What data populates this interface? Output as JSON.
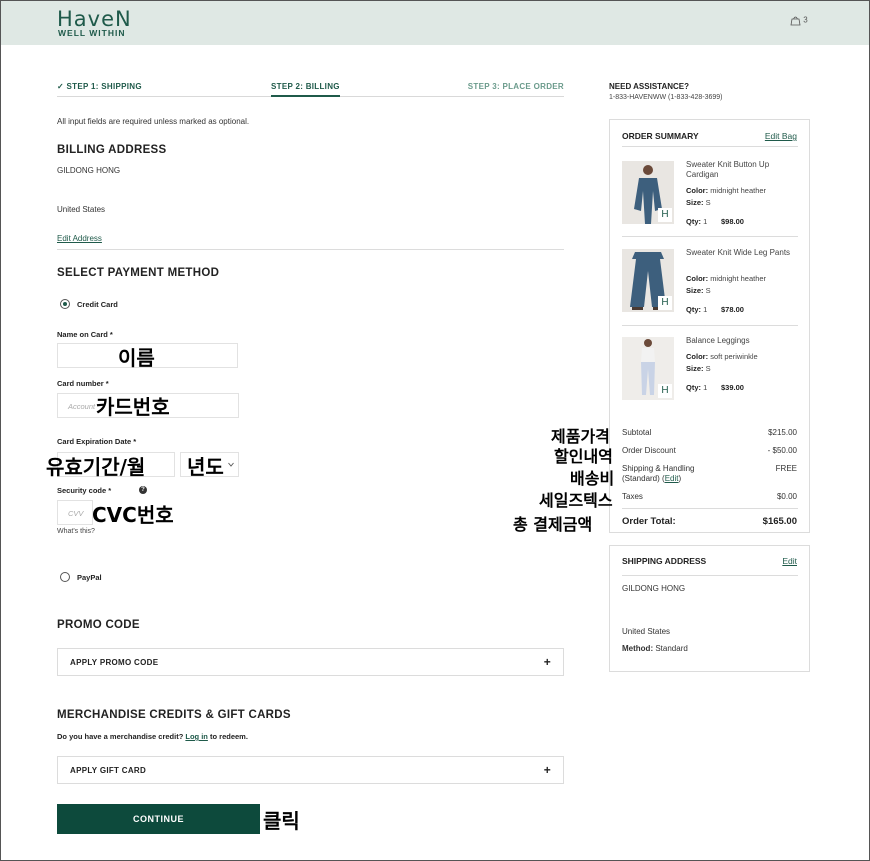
{
  "header": {
    "logo_main": "HaveN",
    "logo_sub": "WELL WITHIN",
    "bag_count": "3"
  },
  "steps": {
    "step1": "✓ STEP 1: SHIPPING",
    "step2": "STEP 2: BILLING",
    "step3": "STEP 3: PLACE ORDER"
  },
  "billing": {
    "required_note": "All input fields are required unless marked as optional.",
    "title": "BILLING ADDRESS",
    "name": "GILDONG HONG",
    "country": "United States",
    "edit_link": "Edit Address"
  },
  "payment": {
    "title": "SELECT PAYMENT METHOD",
    "credit_card_label": "Credit Card",
    "name_label": "Name on Card *",
    "card_number_label": "Card number *",
    "card_number_placeholder": "Account",
    "expiration_label": "Card Expiration Date *",
    "security_label": "Security code *",
    "security_placeholder": "CVV",
    "whats_this": "What's this?",
    "paypal_label": "PayPal"
  },
  "promo": {
    "title": "PROMO CODE",
    "apply": "APPLY PROMO CODE"
  },
  "credits": {
    "title": "MERCHANDISE CREDITS & GIFT CARDS",
    "question": "Do you have a merchandise credit?",
    "login": "Log in",
    "redeem": "to redeem.",
    "apply": "APPLY GIFT CARD"
  },
  "continue_label": "CONTINUE",
  "assistance": {
    "title": "NEED ASSISTANCE?",
    "phone": "1-833-HAVENWW (1-833-428-3699)"
  },
  "order_summary": {
    "title": "ORDER SUMMARY",
    "edit_bag": "Edit Bag",
    "items": [
      {
        "name": "Sweater Knit Button Up Cardigan",
        "color": "midnight heather",
        "size": "S",
        "qty": "1",
        "price": "$98.00"
      },
      {
        "name": "Sweater Knit Wide Leg Pants",
        "color": "midnight heather",
        "size": "S",
        "qty": "1",
        "price": "$78.00"
      },
      {
        "name": "Balance Leggings",
        "color": "soft periwinkle",
        "size": "S",
        "qty": "1",
        "price": "$39.00"
      }
    ],
    "color_label": "Color:",
    "size_label": "Size:",
    "qty_label": "Qty:",
    "subtotal_label": "Subtotal",
    "subtotal": "$215.00",
    "discount_label": "Order Discount",
    "discount": "- $50.00",
    "shipping_label": "Shipping & Handling",
    "shipping_method": "(Standard) (",
    "shipping_edit": "Edit",
    "shipping_close": ")",
    "shipping": "FREE",
    "taxes_label": "Taxes",
    "taxes": "$0.00",
    "total_label": "Order Total:",
    "total": "$165.00"
  },
  "shipping_address": {
    "title": "SHIPPING ADDRESS",
    "edit": "Edit",
    "name": "GILDONG HONG",
    "country": "United States",
    "method_label": "Method:",
    "method": "Standard"
  },
  "annotations": {
    "name": "이름",
    "card_number": "카드번호",
    "exp_month": "유효기간/월",
    "exp_year": "년도",
    "cvc": "CVC번호",
    "product_price": "제품가격",
    "discount": "할인내역",
    "shipping": "배송비",
    "sales_tax": "세일즈텍스",
    "total": "총 결제금액",
    "click": "클릭"
  }
}
